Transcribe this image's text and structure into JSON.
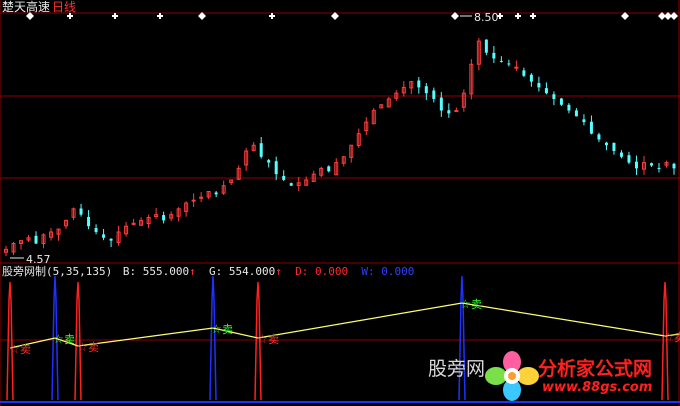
{
  "header": {
    "stock_name": "楚天高速",
    "period": "日线"
  },
  "price_panel": {
    "high_label": "8.50",
    "low_label": "4.57"
  },
  "indicator_panel": {
    "name": "股旁网制",
    "params": "(5,35,135)",
    "fields": [
      {
        "key": "B:",
        "value": "555.000",
        "color": "#e8e8e8"
      },
      {
        "key": "G:",
        "value": "554.000",
        "color": "#e8e8e8"
      },
      {
        "key": "D:",
        "value": "0.000",
        "color": "#ff2a2a"
      },
      {
        "key": "W:",
        "value": "0.000",
        "color": "#2b40ff"
      }
    ],
    "markers": [
      {
        "type": "sell",
        "label": "卖",
        "color": "#ff3030"
      },
      {
        "type": "buy",
        "label": "卖",
        "color": "#30ff30"
      }
    ]
  },
  "watermark": {
    "left_text": "股旁网",
    "brand": "分析家公式网",
    "url": "www.88gs.com"
  },
  "colors": {
    "background": "#000000",
    "up_candle": "#ff3c3c",
    "down_candle": "#54ffff",
    "grid": "#8b0000",
    "yellow_line": "#ffff70",
    "blue_signal": "#2030ff",
    "red_signal": "#ff2020"
  },
  "chart_data": {
    "type": "candlestick",
    "price_high": 8.5,
    "price_low": 4.57,
    "close_series": [
      4.6,
      4.7,
      4.75,
      4.8,
      4.7,
      4.85,
      4.9,
      4.95,
      5.1,
      5.3,
      5.2,
      5.0,
      4.9,
      4.8,
      4.75,
      4.9,
      5.0,
      5.05,
      5.1,
      5.15,
      5.2,
      5.1,
      5.2,
      5.3,
      5.4,
      5.45,
      5.5,
      5.6,
      5.55,
      5.7,
      5.8,
      6.0,
      6.3,
      6.4,
      6.2,
      6.1,
      5.9,
      5.8,
      5.7,
      5.75,
      5.8,
      5.9,
      6.0,
      5.95,
      6.1,
      6.2,
      6.4,
      6.6,
      6.8,
      7.0,
      7.1,
      7.2,
      7.3,
      7.4,
      7.5,
      7.4,
      7.3,
      7.2,
      7.0,
      6.95,
      7.0,
      7.3,
      7.8,
      8.2,
      8.0,
      7.9,
      7.85,
      7.8,
      7.75,
      7.6,
      7.5,
      7.4,
      7.3,
      7.2,
      7.1,
      7.0,
      6.9,
      6.8,
      6.6,
      6.5,
      6.4,
      6.3,
      6.2,
      6.1,
      6.0,
      6.1,
      6.05,
      6.0,
      6.1,
      6.0
    ],
    "indicator": {
      "B": 555.0,
      "G": 554.0,
      "D": 0.0,
      "W": 0.0
    }
  }
}
